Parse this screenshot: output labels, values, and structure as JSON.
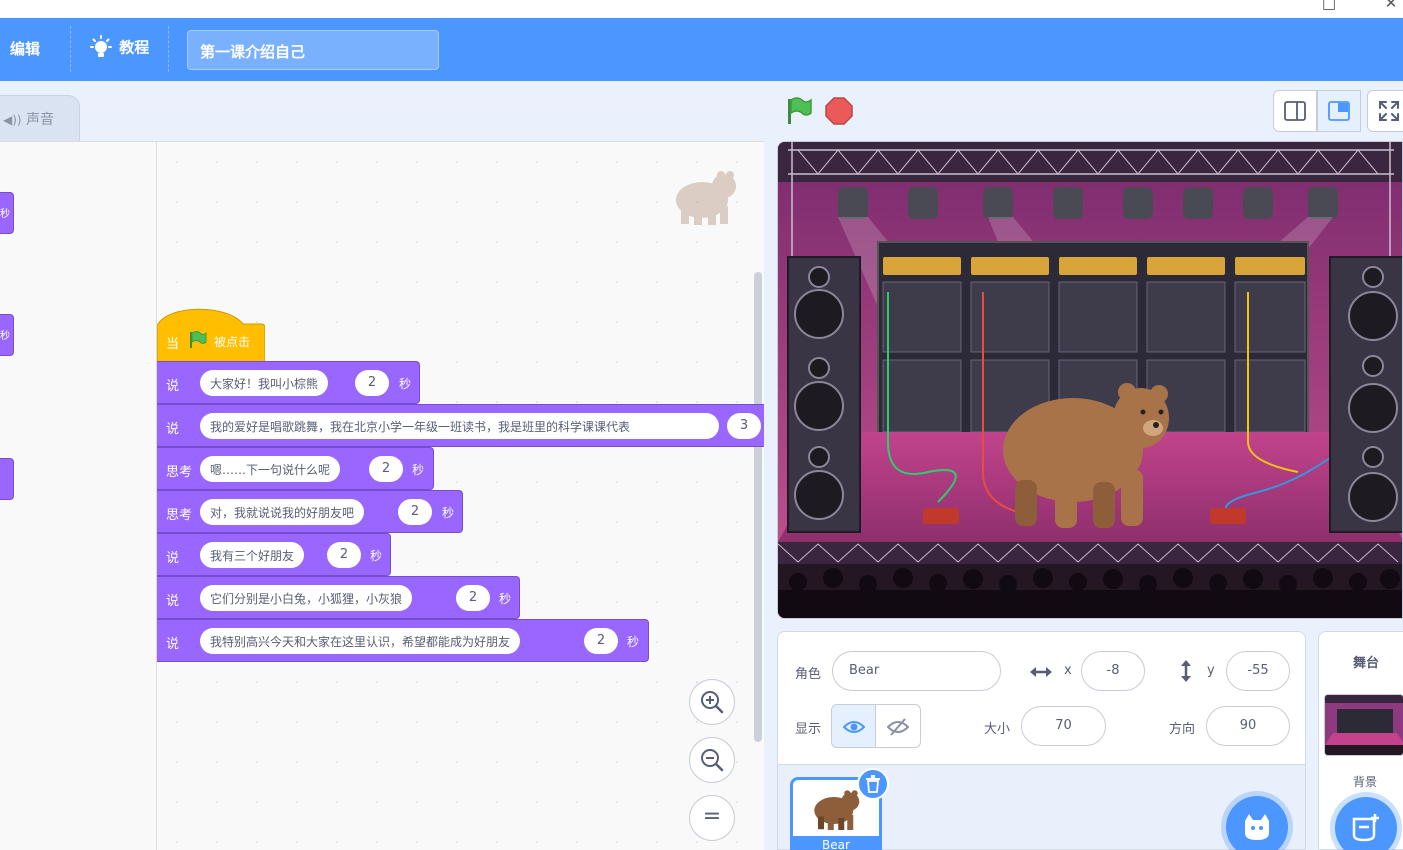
{
  "menubar": {
    "edit_label": "编辑",
    "tutorials_label": "教程",
    "project_title": "第一课介绍自己"
  },
  "tabs": {
    "sound_label": "声音"
  },
  "palette": {
    "stub_sec": "秒"
  },
  "code": {
    "hat": {
      "when": "当",
      "clicked": "被点击"
    },
    "blocks": [
      {
        "keyword": "说",
        "text": "大家好！我叫小棕熊",
        "secs": "2",
        "unit": "秒"
      },
      {
        "keyword": "说",
        "text": "我的爱好是唱歌跳舞，我在北京小学一年级一班读书，我是班里的科学课课代表",
        "secs": "3",
        "unit": ""
      },
      {
        "keyword": "思考",
        "text": "嗯……下一句说什么呢",
        "secs": "2",
        "unit": "秒"
      },
      {
        "keyword": "思考",
        "text": "对，我就说说我的好朋友吧",
        "secs": "2",
        "unit": "秒"
      },
      {
        "keyword": "说",
        "text": "我有三个好朋友",
        "secs": "2",
        "unit": "秒"
      },
      {
        "keyword": "说",
        "text": "它们分别是小白兔，小狐狸，小灰狼",
        "secs": "2",
        "unit": "秒"
      },
      {
        "keyword": "说",
        "text": "我特别高兴今天和大家在这里认识，希望都能成为好朋友",
        "secs": "2",
        "unit": "秒"
      }
    ]
  },
  "zoom": {
    "zoom_in": "+",
    "zoom_out": "−",
    "reset": "="
  },
  "sprite_info": {
    "sprite_label": "角色",
    "sprite_name": "Bear",
    "x_label": "x",
    "x_value": "-8",
    "y_label": "y",
    "y_value": "-55",
    "show_label": "显示",
    "size_label": "大小",
    "size_value": "70",
    "direction_label": "方向",
    "direction_value": "90"
  },
  "sprite_list": {
    "items": [
      {
        "name": "Bear"
      }
    ]
  },
  "stage_target": {
    "title": "舞台",
    "backdrops_label": "背景"
  },
  "colors": {
    "menu_blue": "#4c97ff",
    "looks_purple": "#9966ff",
    "events_yellow": "#ffbf00",
    "flag_green": "#4cbf56",
    "stop_red": "#ec5959"
  },
  "icons": [
    "bulb-icon",
    "speaker-icon",
    "green-flag-icon",
    "stop-icon",
    "zoom-in-icon",
    "zoom-out-icon",
    "zoom-reset-icon",
    "eye-icon",
    "eye-slash-icon",
    "trash-icon",
    "add-sprite-icon",
    "add-backdrop-icon",
    "small-stage-icon",
    "normal-stage-icon",
    "fullscreen-icon"
  ]
}
